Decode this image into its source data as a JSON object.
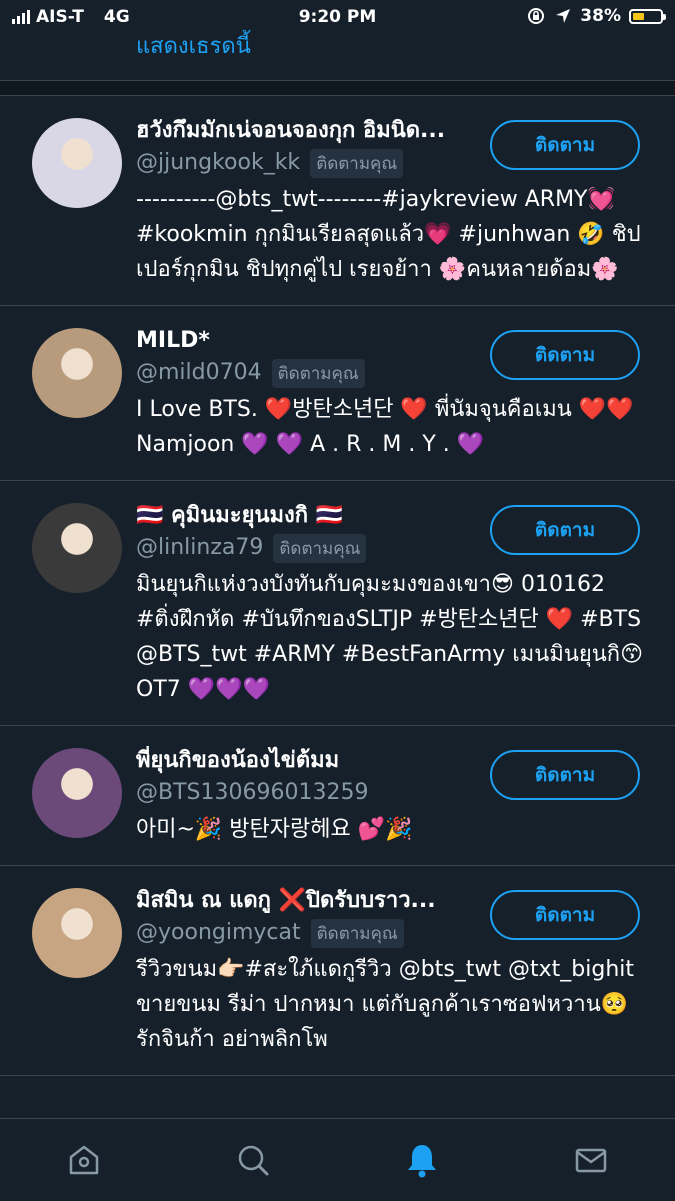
{
  "status_bar": {
    "carrier": "AIS-T",
    "network": "4G",
    "time": "9:20 PM",
    "battery_percent": "38%"
  },
  "show_thread": "แสดงเธรดนี้",
  "follow_label": "ติดตาม",
  "follows_you": "ติดตามคุณ",
  "users": [
    {
      "name": "ฮวังกึมมักเน่จอนจองกุก อิมนิด...",
      "handle": "@jjungkook_kk",
      "follows_you": true,
      "bio": "----------@bts_twt--------#jaykreview ARMY💓 #kookmin กุกมินเรียลสุดแล้ว💗 #junhwan 🤣 ชิปเปอร์กุกมิน ชิปทุกคู่ไป เรยจย้าา 🌸คนหลายด้อม🌸",
      "avatar_color": "#d9d6e6"
    },
    {
      "name": "MILD*",
      "handle": "@mild0704",
      "follows_you": true,
      "bio": "I Love BTS. ❤️방탄소년단 ❤️ พี่นัมจุนคือเมน ❤️❤️ Namjoon 💜 💜 A . R . M . Y . 💜",
      "avatar_color": "#b89a7c"
    },
    {
      "name": "🇹🇭 คุมินมะยุนมงกิ 🇹🇭",
      "handle": "@linlinza79",
      "follows_you": true,
      "bio": "มินยุนกิแห่งวงบังทันกับคุมะมงของเขา😎 010162 #ติ่งฝึกหัด #บันทึกของSLTJP #방탄소년단 ❤️ #BTS @BTS_twt #ARMY #BestFanArmy เมนมินยุนกิ😙 OT7 💜💜💜",
      "avatar_color": "#3a3a3a"
    },
    {
      "name": "พี่ยุนกิของน้องไข่ต้มม",
      "handle": "@BTS130696013259",
      "follows_you": false,
      "bio": "아미~🎉 방탄자랑헤요 💕🎉",
      "avatar_color": "#6b4a7a"
    },
    {
      "name": "มิสมิน ณ แดกู ❌ปิดรับบราว...",
      "handle": "@yoongimycat",
      "follows_you": true,
      "bio": "รีวิวขนม👉🏻#สะใภ้แดกูรีวิว @bts_twt @txt_bighit ขายขนม รีม่า ปากหมา แต่กับลูกค้าเราซอฟหวาน🥺 รักจินก้า อย่าพลิกโพ",
      "avatar_color": "#c7a582"
    }
  ],
  "tabs": [
    {
      "name": "home-icon",
      "active": false
    },
    {
      "name": "search-icon",
      "active": false
    },
    {
      "name": "notifications-icon",
      "active": true
    },
    {
      "name": "messages-icon",
      "active": false
    }
  ],
  "colors": {
    "background": "#15202b",
    "accent": "#1da1f2",
    "secondary_text": "#8899a6",
    "divider": "#38444d"
  }
}
